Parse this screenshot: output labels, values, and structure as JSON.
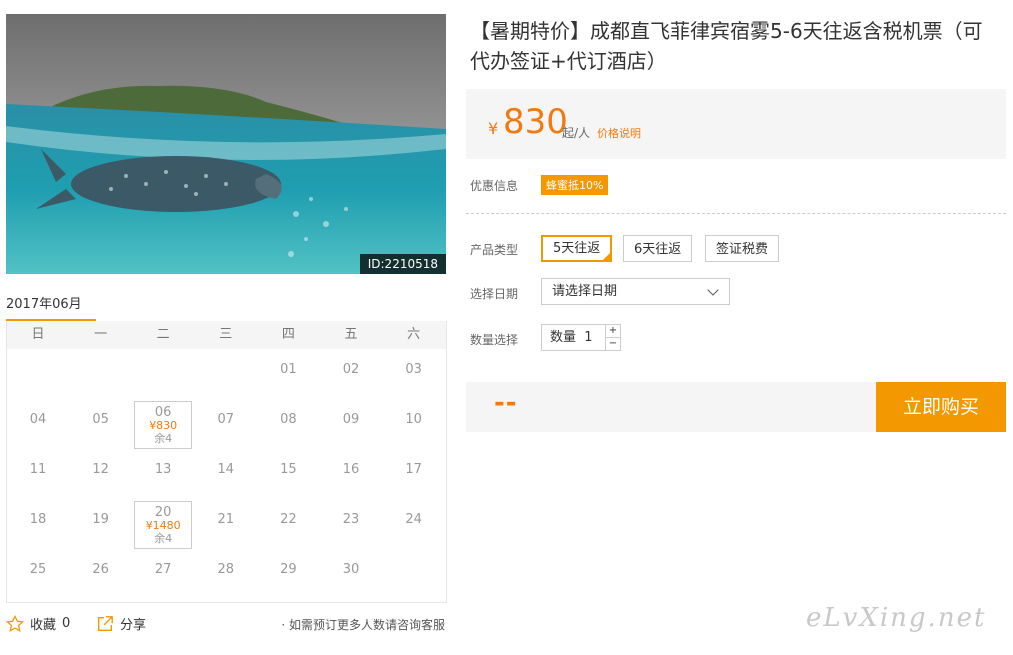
{
  "photo": {
    "id_label": "ID:2210518"
  },
  "calendar": {
    "month": "2017年06月",
    "weekdays": [
      "日",
      "一",
      "二",
      "三",
      "四",
      "五",
      "六"
    ],
    "days": [
      {
        "num": "01",
        "col": 4,
        "row": 0
      },
      {
        "num": "02",
        "col": 5,
        "row": 0
      },
      {
        "num": "03",
        "col": 6,
        "row": 0
      },
      {
        "num": "04",
        "col": 0,
        "row": 1
      },
      {
        "num": "05",
        "col": 1,
        "row": 1
      },
      {
        "num": "06",
        "col": 2,
        "row": 1,
        "price": "¥830",
        "left": "余4"
      },
      {
        "num": "07",
        "col": 3,
        "row": 1
      },
      {
        "num": "08",
        "col": 4,
        "row": 1
      },
      {
        "num": "09",
        "col": 5,
        "row": 1
      },
      {
        "num": "10",
        "col": 6,
        "row": 1
      },
      {
        "num": "11",
        "col": 0,
        "row": 2
      },
      {
        "num": "12",
        "col": 1,
        "row": 2
      },
      {
        "num": "13",
        "col": 2,
        "row": 2
      },
      {
        "num": "14",
        "col": 3,
        "row": 2
      },
      {
        "num": "15",
        "col": 4,
        "row": 2
      },
      {
        "num": "16",
        "col": 5,
        "row": 2
      },
      {
        "num": "17",
        "col": 6,
        "row": 2
      },
      {
        "num": "18",
        "col": 0,
        "row": 3
      },
      {
        "num": "19",
        "col": 1,
        "row": 3
      },
      {
        "num": "20",
        "col": 2,
        "row": 3,
        "price": "¥1480",
        "left": "余4"
      },
      {
        "num": "21",
        "col": 3,
        "row": 3
      },
      {
        "num": "22",
        "col": 4,
        "row": 3
      },
      {
        "num": "23",
        "col": 5,
        "row": 3
      },
      {
        "num": "24",
        "col": 6,
        "row": 3
      },
      {
        "num": "25",
        "col": 0,
        "row": 4
      },
      {
        "num": "26",
        "col": 1,
        "row": 4
      },
      {
        "num": "27",
        "col": 2,
        "row": 4
      },
      {
        "num": "28",
        "col": 3,
        "row": 4
      },
      {
        "num": "29",
        "col": 4,
        "row": 4
      },
      {
        "num": "30",
        "col": 5,
        "row": 4
      }
    ]
  },
  "actions": {
    "favorite_label": "收藏",
    "favorite_count": "0",
    "share_label": "分享",
    "note": "· 如需预订更多人数请咨询客服"
  },
  "product": {
    "title": "【暑期特价】成都直飞菲律宾宿雾5-6天往返含税机票（可代办签证+代订酒店）",
    "price_symbol": "¥",
    "price": "830",
    "price_unit": "起/人",
    "price_explain": "价格说明",
    "promo_label": "优惠信息",
    "promo_badge": "蜂蜜抵10%",
    "type_label": "产品类型",
    "types": [
      "5天往返",
      "6天往返",
      "签证税费"
    ],
    "date_label": "选择日期",
    "date_placeholder": "请选择日期",
    "qty_label": "数量选择",
    "qty_text": "数量",
    "qty_value": "1",
    "total": "--",
    "buy_label": "立即购买"
  },
  "watermark": "eLvXing.net",
  "colors": {
    "accent": "#f39800",
    "price": "#f07a12"
  }
}
